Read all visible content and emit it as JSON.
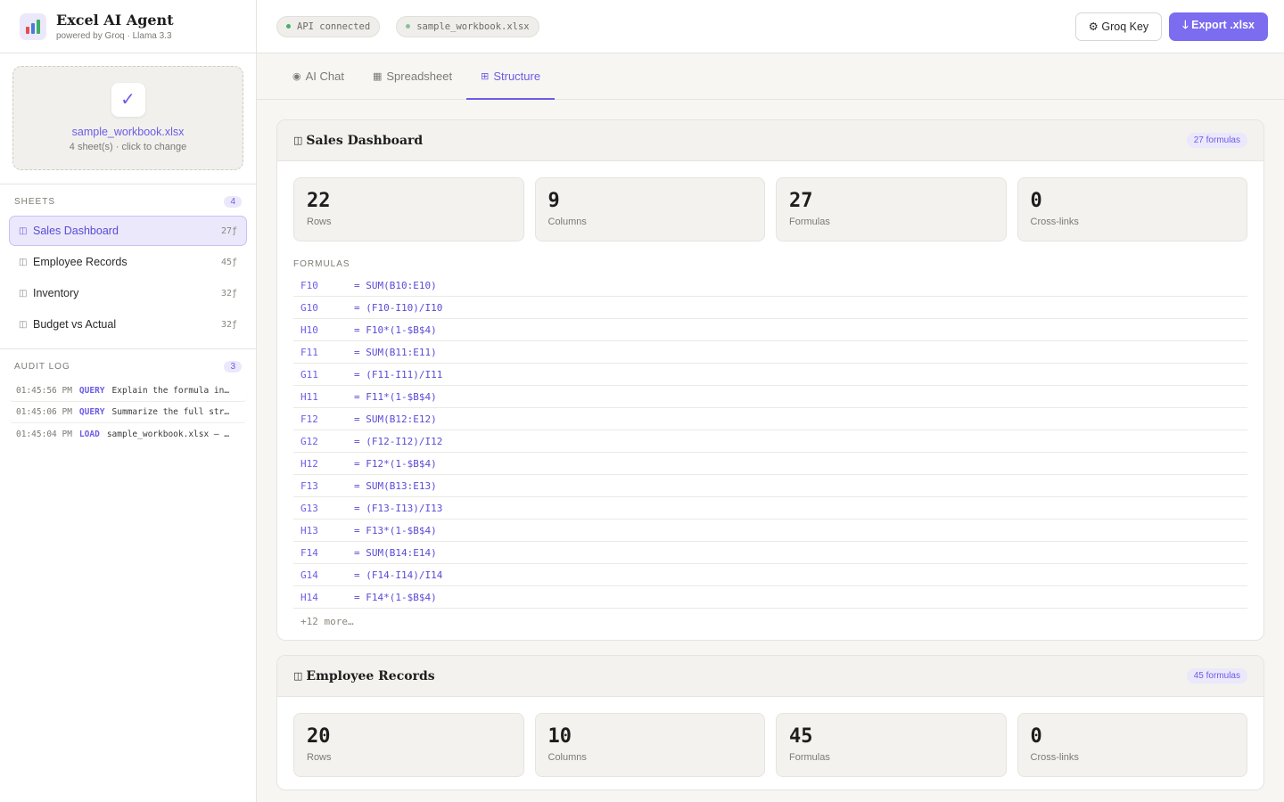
{
  "brand": {
    "title": "Excel AI Agent",
    "subtitle": "powered by Groq · Llama 3.3"
  },
  "upload": {
    "check": "✓",
    "filename": "sample_workbook.xlsx",
    "hint": "4 sheet(s) · click to change"
  },
  "sheets": {
    "label": "SHEETS",
    "count": "4",
    "items": [
      {
        "name": "Sales Dashboard",
        "formulas": "27ƒ"
      },
      {
        "name": "Employee Records",
        "formulas": "45ƒ"
      },
      {
        "name": "Inventory",
        "formulas": "32ƒ"
      },
      {
        "name": "Budget vs Actual",
        "formulas": "32ƒ"
      }
    ]
  },
  "audit": {
    "label": "AUDIT LOG",
    "count": "3",
    "items": [
      {
        "time": "01:45:56 PM",
        "type": "QUERY",
        "message": "Explain the formula in…"
      },
      {
        "time": "01:45:06 PM",
        "type": "QUERY",
        "message": "Summarize the full str…"
      },
      {
        "time": "01:45:04 PM",
        "type": "LOAD",
        "message": "sample_workbook.xlsx — …"
      }
    ]
  },
  "topbar": {
    "status": "API connected",
    "status_color": "#4caf6a",
    "file": "sample_workbook.xlsx",
    "file_color": "#8fbf9a",
    "key_label": "⚙ Groq Key",
    "export_label": "🡓 Export .xlsx"
  },
  "tabs": [
    {
      "icon": "◉",
      "label": "AI Chat"
    },
    {
      "icon": "▦",
      "label": "Spreadsheet"
    },
    {
      "icon": "⊞",
      "label": "Structure"
    }
  ],
  "cards": [
    {
      "title": "Sales Dashboard",
      "badge": "27 formulas",
      "stats": [
        {
          "value": "22",
          "label": "Rows"
        },
        {
          "value": "9",
          "label": "Columns"
        },
        {
          "value": "27",
          "label": "Formulas"
        },
        {
          "value": "0",
          "label": "Cross-links"
        }
      ],
      "formulas_label": "FORMULAS",
      "formulas": [
        {
          "cell": "F10",
          "expr": "= SUM(B10:E10)"
        },
        {
          "cell": "G10",
          "expr": "= (F10-I10)/I10"
        },
        {
          "cell": "H10",
          "expr": "= F10*(1-$B$4)"
        },
        {
          "cell": "F11",
          "expr": "= SUM(B11:E11)"
        },
        {
          "cell": "G11",
          "expr": "= (F11-I11)/I11"
        },
        {
          "cell": "H11",
          "expr": "= F11*(1-$B$4)"
        },
        {
          "cell": "F12",
          "expr": "= SUM(B12:E12)"
        },
        {
          "cell": "G12",
          "expr": "= (F12-I12)/I12"
        },
        {
          "cell": "H12",
          "expr": "= F12*(1-$B$4)"
        },
        {
          "cell": "F13",
          "expr": "= SUM(B13:E13)"
        },
        {
          "cell": "G13",
          "expr": "= (F13-I13)/I13"
        },
        {
          "cell": "H13",
          "expr": "= F13*(1-$B$4)"
        },
        {
          "cell": "F14",
          "expr": "= SUM(B14:E14)"
        },
        {
          "cell": "G14",
          "expr": "= (F14-I14)/I14"
        },
        {
          "cell": "H14",
          "expr": "= F14*(1-$B$4)"
        }
      ],
      "more": "+12 more…"
    },
    {
      "title": "Employee Records",
      "badge": "45 formulas",
      "stats": [
        {
          "value": "20",
          "label": "Rows"
        },
        {
          "value": "10",
          "label": "Columns"
        },
        {
          "value": "45",
          "label": "Formulas"
        },
        {
          "value": "0",
          "label": "Cross-links"
        }
      ]
    }
  ]
}
